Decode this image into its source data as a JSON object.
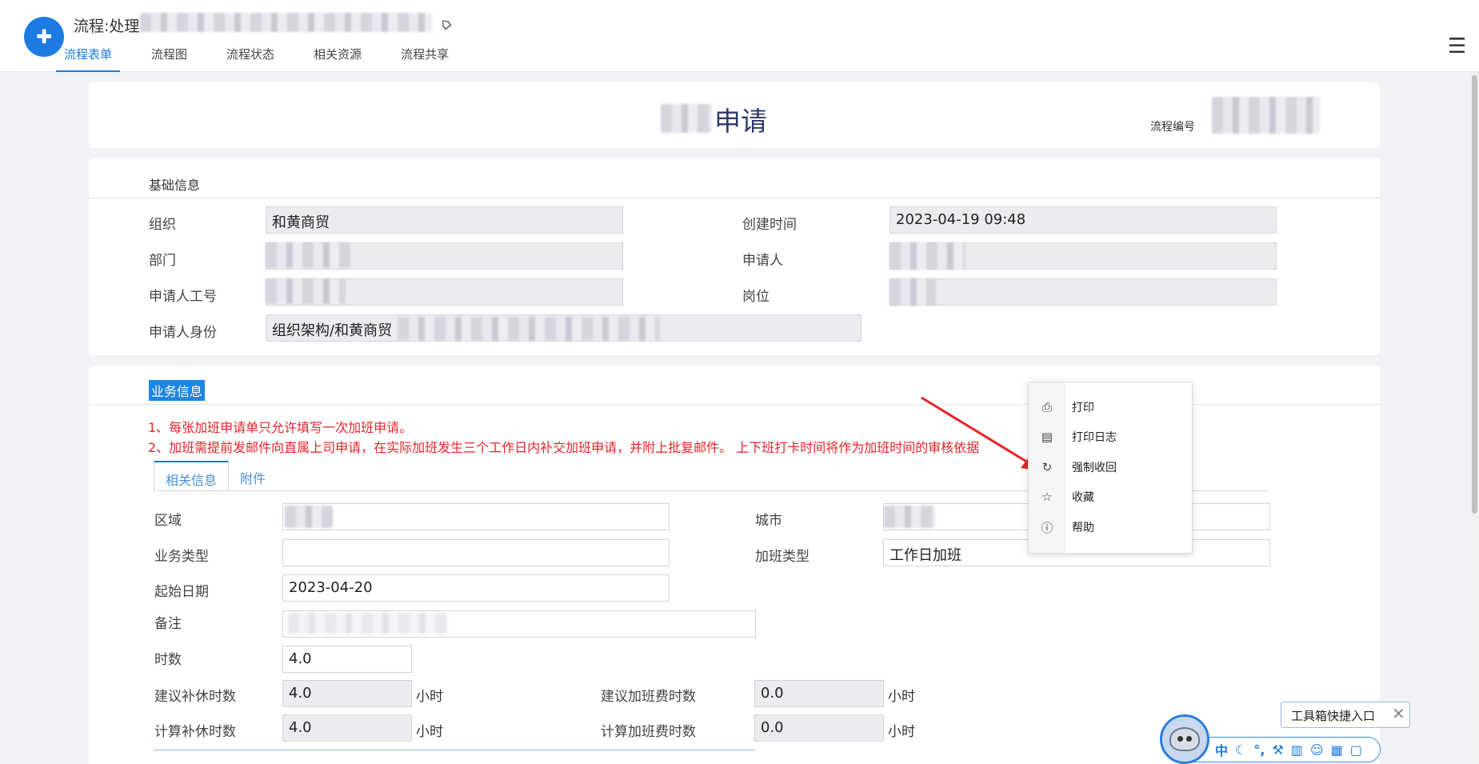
{
  "header": {
    "title": "流程:处理",
    "tabs": [
      {
        "label": "流程表单",
        "active": true
      },
      {
        "label": "流程图"
      },
      {
        "label": "流程状态"
      },
      {
        "label": "相关资源"
      },
      {
        "label": "流程共享"
      }
    ]
  },
  "form": {
    "title": "申请",
    "flow_no_label": "流程编号"
  },
  "basic": {
    "section": "基础信息",
    "org_label": "组织",
    "org_value": "和黄商贸",
    "created_label": "创建时间",
    "created_value": "2023-04-19 09:48",
    "dept_label": "部门",
    "applicant_label": "申请人",
    "emp_no_label": "申请人工号",
    "post_label": "岗位",
    "identity_label": "申请人身份",
    "identity_value": "组织架构/和黄商贸"
  },
  "business": {
    "section": "业务信息",
    "notice1": "1、每张加班申请单只允许填写一次加班申请。",
    "notice2": "2、加班需提前发邮件向直属上司申请，在实际加班发生三个工作日内补交加班申请，并附上批复邮件。 上下班打卡时间将作为加班时间的审核依据",
    "tabs": [
      "相关信息",
      "附件"
    ],
    "region_label": "区域",
    "city_label": "城市",
    "biz_type_label": "业务类型",
    "ot_type_label": "加班类型",
    "ot_type_value": "工作日加班",
    "start_date_label": "起始日期",
    "start_date_value": "2023-04-20",
    "remark_label": "备注",
    "hours_label": "时数",
    "hours_value": "4.0",
    "sugg_comp_label": "建议补休时数",
    "sugg_comp_value": "4.0",
    "sugg_fee_label": "建议加班费时数",
    "sugg_fee_value": "0.0",
    "calc_comp_label": "计算补休时数",
    "calc_comp_value": "4.0",
    "calc_fee_label": "计算加班费时数",
    "calc_fee_value": "0.0",
    "unit": "小时"
  },
  "context_menu": {
    "items": [
      {
        "label": "打印",
        "icon": "printer-icon"
      },
      {
        "label": "打印日志",
        "icon": "clipboard-icon"
      },
      {
        "label": "强制收回",
        "icon": "redo-icon"
      },
      {
        "label": "收藏",
        "icon": "star-icon"
      },
      {
        "label": "帮助",
        "icon": "help-icon"
      }
    ]
  },
  "toolbox": {
    "tip": "工具箱快捷入口",
    "icons": [
      "中",
      "moon-icon",
      "dots-icon",
      "wrench-icon",
      "doc-icon",
      "smile-icon",
      "grid-icon",
      "lock-icon"
    ]
  },
  "colors": {
    "accent": "#1c7be0",
    "notice": "#e8232a",
    "arrow": "#e8232a"
  }
}
